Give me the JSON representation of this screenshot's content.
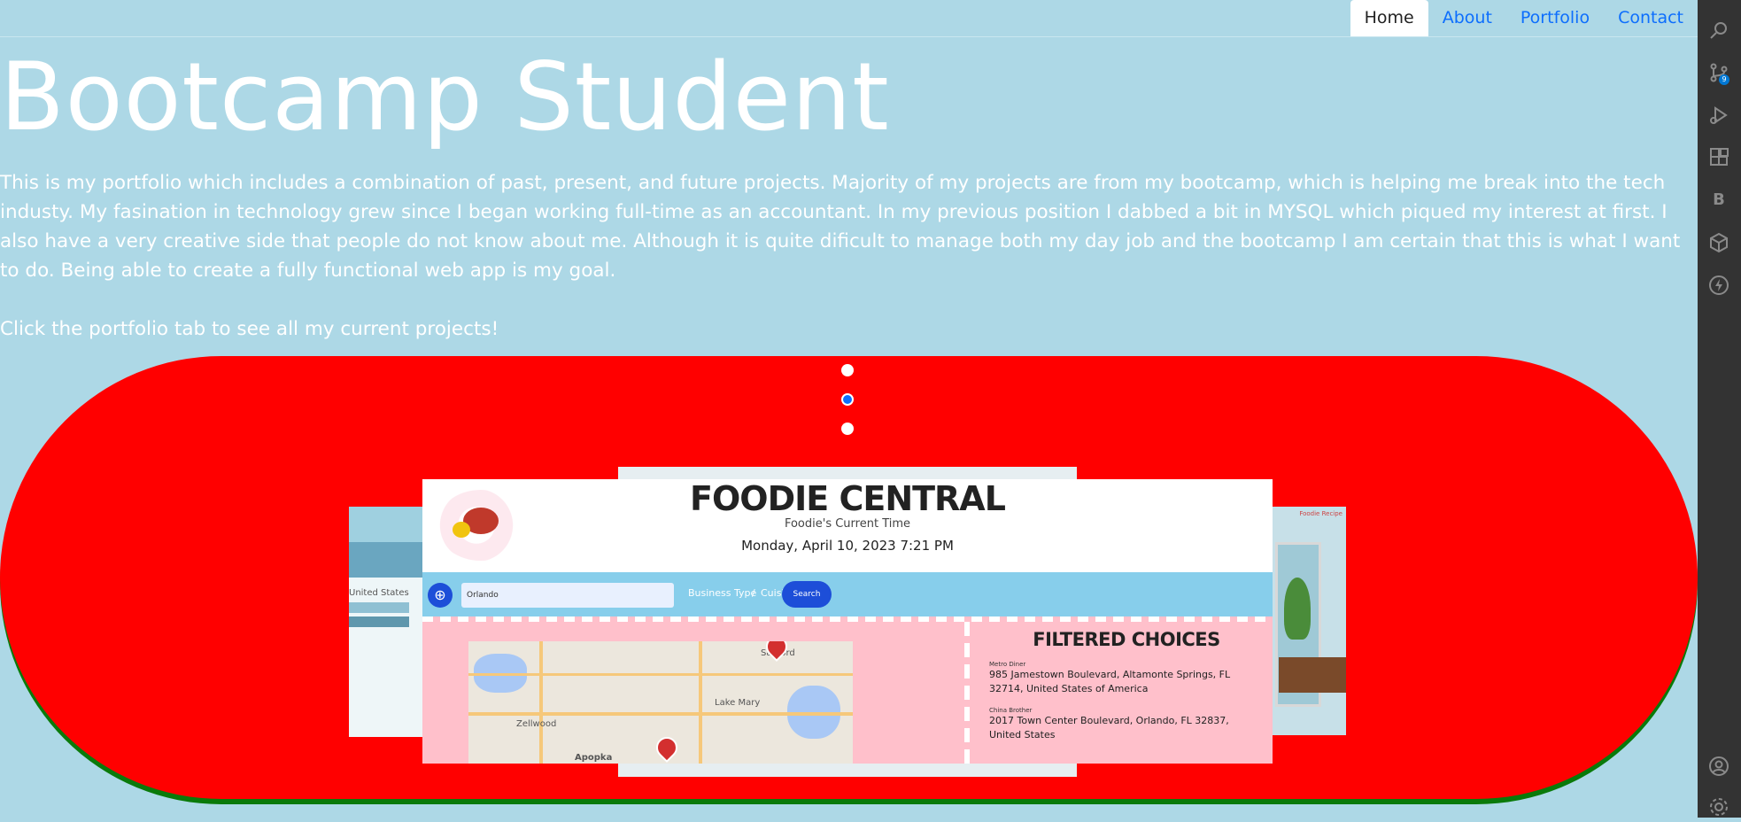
{
  "nav": {
    "tabs": [
      {
        "label": "Home",
        "active": true
      },
      {
        "label": "About",
        "active": false
      },
      {
        "label": "Portfolio",
        "active": false
      },
      {
        "label": "Contact",
        "active": false
      }
    ]
  },
  "hero": {
    "title": "Bootcamp Student",
    "intro": "This is my portfolio which includes a combination of past, present, and future projects. Majority of my projects are from my bootcamp, which is helping me break into the tech industy. My fasination in technology grew since I began working full-time as an accountant. In my previous position I dabbed a bit in MYSQL which piqued my interest at first. I also have a very creative side that people do not know about me. Although it is quite dificult to manage both my day job and the bootcamp I am certain that this is what I want to do. Being able to create a fully functional web app is my goal.",
    "cta": "Click the portfolio tab to see all my current projects!"
  },
  "carousel": {
    "active_index": 1,
    "slide_count": 3,
    "side_left_label": "United States",
    "side_right_sign": "Foodie Recipe",
    "main_slide": {
      "title": "FOODIE CENTRAL",
      "subtitle": "Foodie's Current Time",
      "datetime": "Monday, April 10, 2023 7:21 PM",
      "search_value": "Orlando",
      "filter_business": "Business Type",
      "filter_sep": "/",
      "filter_cuisine": "Cuisine",
      "search_button": "Search",
      "map_labels": [
        "Sanford",
        "Lake Mary",
        "Zellwood",
        "Apopka"
      ],
      "filtered_heading": "FILTERED CHOICES",
      "results": [
        {
          "name": "Metro Diner",
          "address": "985 Jamestown Boulevard, Altamonte Springs, FL 32714, United States of America"
        },
        {
          "name": "China Brother",
          "address": "2017 Town Center Boulevard, Orlando, FL 32837, United States"
        }
      ]
    }
  },
  "activity_bar": {
    "icons": [
      "search-icon",
      "source-control-icon",
      "run-debug-icon",
      "extensions-icon",
      "b-icon",
      "box-icon",
      "lightning-icon",
      "account-icon",
      "settings-gear-icon"
    ],
    "source_control_badge": "9",
    "b_label": "B"
  }
}
